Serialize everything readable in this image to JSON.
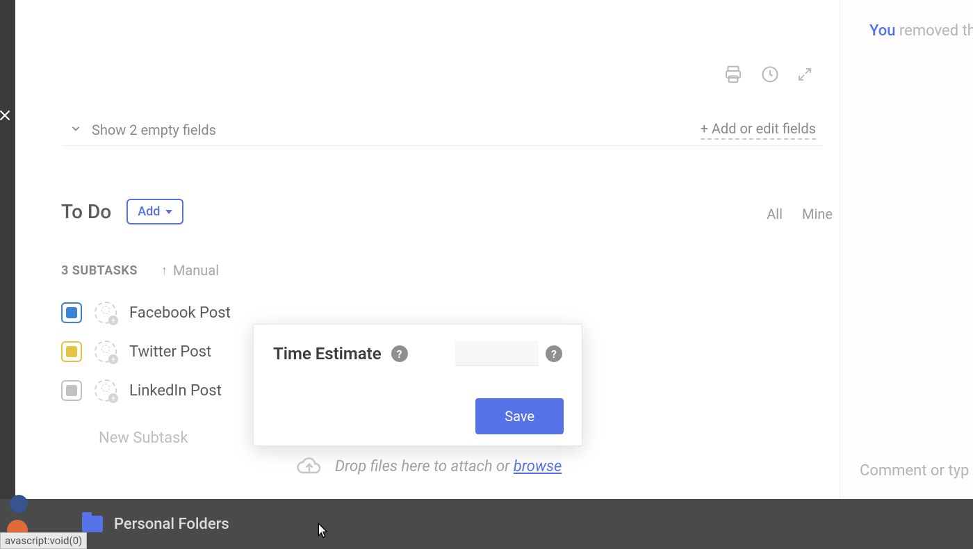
{
  "emptyFields": {
    "toggleLabel": "Show 2 empty fields",
    "editLabel": "+ Add or edit fields"
  },
  "section": {
    "title": "To Do",
    "addLabel": "Add",
    "filterAll": "All",
    "filterMine": "Mine"
  },
  "subtasksHeader": {
    "countLabel": "3 SUBTASKS",
    "sortLabel": "Manual"
  },
  "subtasks": [
    {
      "name": "Facebook Post",
      "status": "blue"
    },
    {
      "name": "Twitter Post",
      "status": "yellow"
    },
    {
      "name": "LinkedIn Post",
      "status": "grey"
    }
  ],
  "newSubtaskPlaceholder": "New Subtask",
  "popover": {
    "label": "Time Estimate",
    "saveLabel": "Save",
    "inputValue": ""
  },
  "dropZone": {
    "text": "Drop files here to attach or ",
    "browse": "browse"
  },
  "activity": {
    "you": "You",
    "action": " removed th"
  },
  "commentPlaceholder": "Comment or typ",
  "bottomBar": {
    "folder": "Personal Folders"
  },
  "statusBar": "avascript:void(0)"
}
